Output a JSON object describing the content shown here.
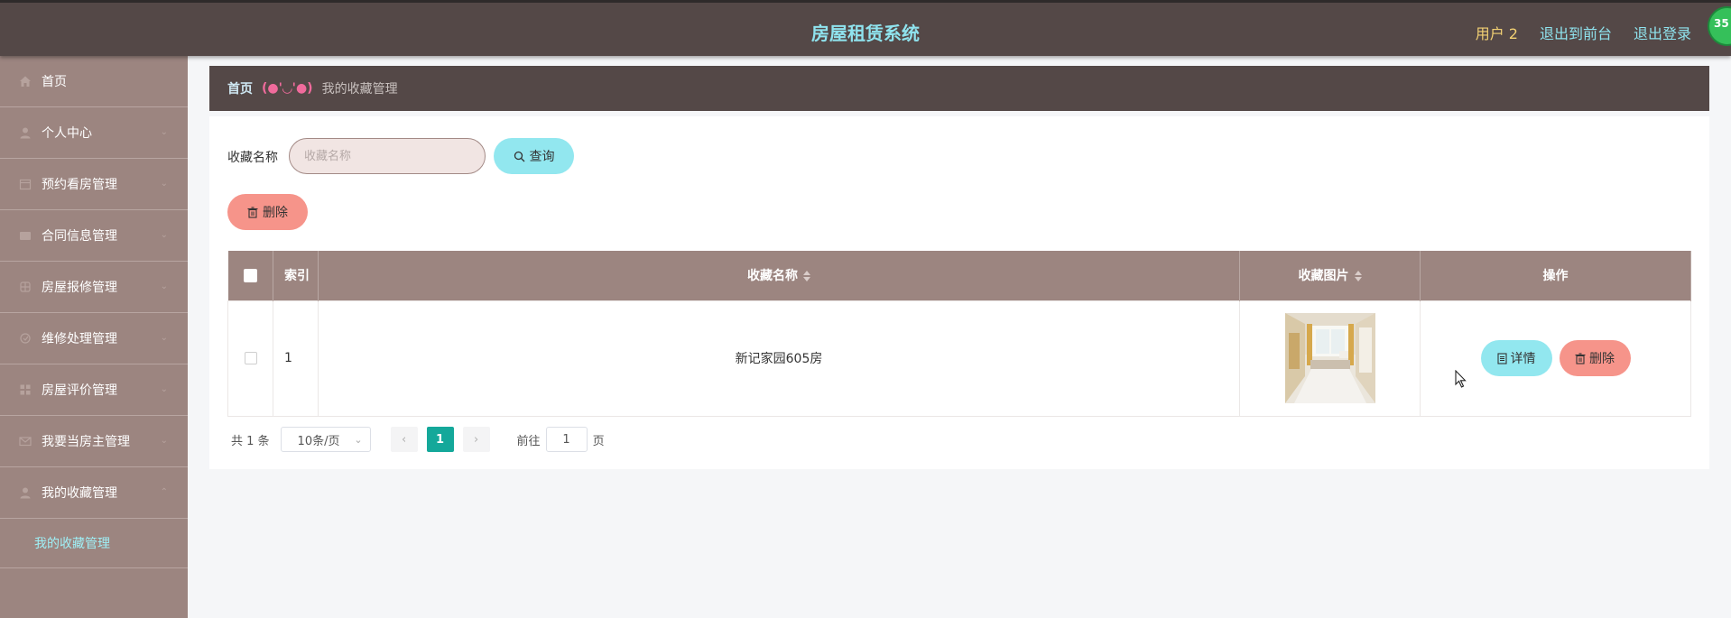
{
  "header": {
    "title": "房屋租赁系统",
    "user": "用户 2",
    "links": [
      "退出到前台",
      "退出登录"
    ],
    "badge": "35"
  },
  "sidebar": {
    "items": [
      {
        "label": "首页",
        "icon": "home-icon",
        "has_arrow": false
      },
      {
        "label": "个人中心",
        "icon": "user-icon",
        "has_arrow": true
      },
      {
        "label": "预约看房管理",
        "icon": "calendar-icon",
        "has_arrow": true
      },
      {
        "label": "合同信息管理",
        "icon": "contract-icon",
        "has_arrow": true
      },
      {
        "label": "房屋报修管理",
        "icon": "repair-icon",
        "has_arrow": true
      },
      {
        "label": "维修处理管理",
        "icon": "wrench-icon",
        "has_arrow": true
      },
      {
        "label": "房屋评价管理",
        "icon": "grid-icon",
        "has_arrow": true
      },
      {
        "label": "我要当房主管理",
        "icon": "mail-icon",
        "has_arrow": true
      },
      {
        "label": "我的收藏管理",
        "icon": "person-icon",
        "has_arrow": true,
        "expanded": true
      }
    ],
    "submenu": {
      "label": "我的收藏管理"
    }
  },
  "breadcrumb": {
    "home": "首页",
    "separator": "(●'◡'●)",
    "current": "我的收藏管理"
  },
  "search": {
    "label": "收藏名称",
    "placeholder": "收藏名称",
    "value": "",
    "button": "查询"
  },
  "actions": {
    "delete": "删除"
  },
  "table": {
    "columns": [
      "索引",
      "收藏名称",
      "收藏图片",
      "操作"
    ],
    "rows": [
      {
        "index": "1",
        "name": "新记家园605房",
        "image": "room-photo",
        "detail": "详情",
        "delete": "删除"
      }
    ]
  },
  "pagination": {
    "total": "共 1 条",
    "page_size": "10条/页",
    "current_page": "1",
    "goto_label": "前往",
    "goto_value": "1",
    "goto_suffix": "页"
  },
  "colors": {
    "header_bg": "#544847",
    "title": "#8fe3ee",
    "sidebar_bg": "#9c8580",
    "accent_cyan": "#92e7ef",
    "accent_salmon": "#f6948a",
    "page_active": "#14a89a"
  }
}
